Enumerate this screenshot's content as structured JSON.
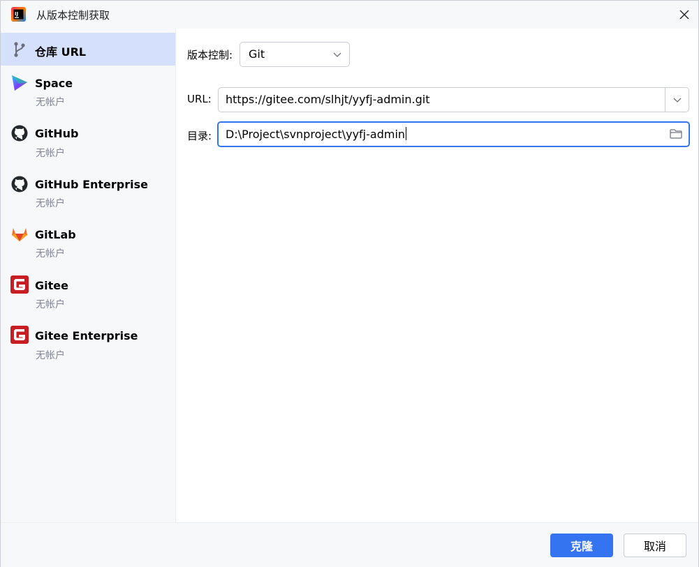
{
  "window": {
    "title": "从版本控制获取"
  },
  "sidebar": {
    "items": [
      {
        "label": "仓库 URL",
        "icon": "vcs-branch-icon",
        "selected": true
      },
      {
        "label": "Space",
        "subtitle": "无帐户",
        "icon": "space-logo-icon"
      },
      {
        "label": "GitHub",
        "subtitle": "无帐户",
        "icon": "github-icon"
      },
      {
        "label": "GitHub Enterprise",
        "subtitle": "无帐户",
        "icon": "github-icon"
      },
      {
        "label": "GitLab",
        "subtitle": "无帐户",
        "icon": "gitlab-icon"
      },
      {
        "label": "Gitee",
        "subtitle": "无帐户",
        "icon": "gitee-icon"
      },
      {
        "label": "Gitee Enterprise",
        "subtitle": "无帐户",
        "icon": "gitee-icon"
      }
    ]
  },
  "main": {
    "vcs_label": "版本控制:",
    "vcs_value": "Git",
    "url_label": "URL:",
    "url_value": "https://gitee.com/slhjt/yyfj-admin.git",
    "dir_label": "目录:",
    "dir_value": "D:\\Project\\svnproject\\yyfj-admin"
  },
  "footer": {
    "clone_label": "克隆",
    "cancel_label": "取消"
  },
  "colors": {
    "accent": "#3574f0",
    "selection": "#d5e1fc",
    "gitlab": "#e24329",
    "gitee": "#c71d23"
  }
}
